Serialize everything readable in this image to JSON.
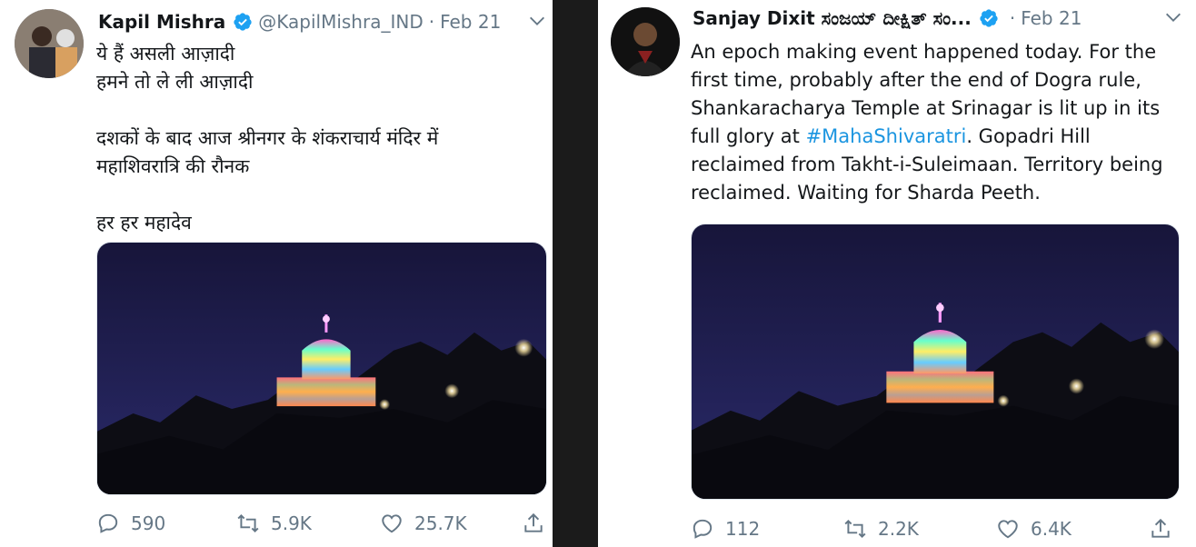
{
  "tweets": [
    {
      "name": "Kapil Mishra",
      "handle": "@KapilMishra_IND",
      "sep": "·",
      "date": "Feb 21",
      "lines": [
        "ये हैं असली आज़ादी",
        "हमने तो ले ली आज़ादी",
        "",
        "दशकों के बाद आज श्रीनगर के शंकराचार्य मंदिर में",
        "महाशिवरात्रि की रौनक",
        "",
        "हर हर महादेव"
      ],
      "replies": "590",
      "retweets": "5.9K",
      "likes": "25.7K"
    },
    {
      "name": "Sanjay Dixit ಸಂಜಯ್ ದೀಕ್ಷಿತ್ ಸಂ...",
      "sep": "·",
      "date": "Feb 21",
      "text_before": "An epoch making event happened today. For the first time, probably after the end of Dogra rule, Shankaracharya Temple at Srinagar is lit up in its full glory at ",
      "hashtag": "#MahaShivaratri",
      "text_after": ". Gopadri Hill reclaimed from Takht-i-Suleimaan. Territory being reclaimed. Waiting for Sharda Peeth.",
      "replies": "112",
      "retweets": "2.2K",
      "likes": "6.4K"
    }
  ],
  "icons": {
    "verified": "verified-badge-icon",
    "chevron": "chevron-down-icon",
    "reply": "reply-icon",
    "retweet": "retweet-icon",
    "like": "heart-icon",
    "share": "share-icon"
  },
  "colors": {
    "verified": "#1da1f2",
    "hashtag": "#1b95e0",
    "muted": "#657786"
  }
}
